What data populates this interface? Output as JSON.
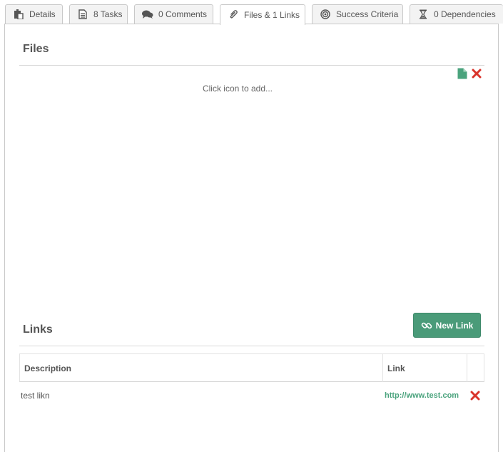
{
  "tabs": [
    {
      "label": "Details",
      "icon": "clipboard-icon"
    },
    {
      "label": "8 Tasks",
      "icon": "document-icon"
    },
    {
      "label": "0 Comments",
      "icon": "comments-icon"
    },
    {
      "label": "Files & 1 Links",
      "icon": "paperclip-icon"
    },
    {
      "label": "Success Criteria",
      "icon": "target-icon"
    },
    {
      "label": "0 Dependencies",
      "icon": "hourglass-icon"
    }
  ],
  "files": {
    "title": "Files",
    "empty_hint": "Click icon to add..."
  },
  "links": {
    "title": "Links",
    "new_link_label": "New Link",
    "columns": {
      "description": "Description",
      "link": "Link"
    },
    "rows": [
      {
        "description": "test likn",
        "link": "http://www.test.com"
      }
    ]
  },
  "colors": {
    "accent": "#4a9b79",
    "link": "#4aa37d",
    "danger": "#d9342b"
  }
}
